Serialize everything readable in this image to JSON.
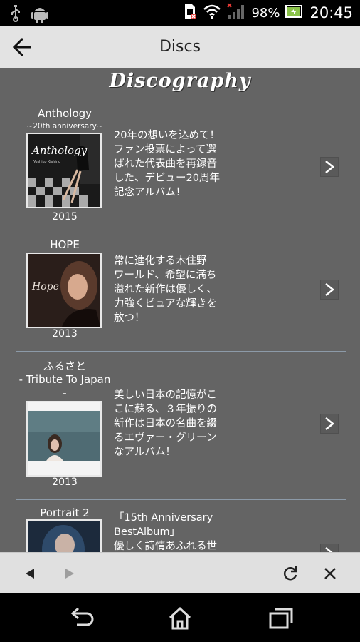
{
  "status_bar": {
    "battery": "98%",
    "time": "20:45"
  },
  "action_bar": {
    "title": "Discs"
  },
  "content": {
    "heading": "Discography",
    "discs": [
      {
        "title": "Anthology",
        "subtitle": "~20th anniversary~",
        "year": "2015",
        "description": "20年の想いを込めて！ファン投票によって選ばれた代表曲を再録音した、デビュー20周年記念アルバム！",
        "description_lines": [
          "20年の想いを込めて！",
          "ファン投票によって選",
          "ばれた代表曲を再録音",
          "した、デビュー20周年",
          "記念アルバム！"
        ]
      },
      {
        "title": "HOPE",
        "year": "2013",
        "description_lines": [
          "常に進化する木住野",
          "ワールド、希望に満ち",
          "溢れた新作は優しく、",
          "力強くピュアな輝きを",
          "放つ！"
        ]
      },
      {
        "title_lines": [
          "ふるさと",
          "- Tribute To Japan",
          "-"
        ],
        "year": "2013",
        "description_lines": [
          "美しい日本の記憶がこ",
          "こに蘇る、３年振りの",
          "新作は日本の名曲を綴",
          "るエヴァー・グリーン",
          "なアルバム！"
        ]
      },
      {
        "title": "Portrait 2",
        "description_lines": [
          "「15th Anniversary",
          "BestAlbum」",
          "優しく詩情あふれる世"
        ]
      }
    ]
  }
}
